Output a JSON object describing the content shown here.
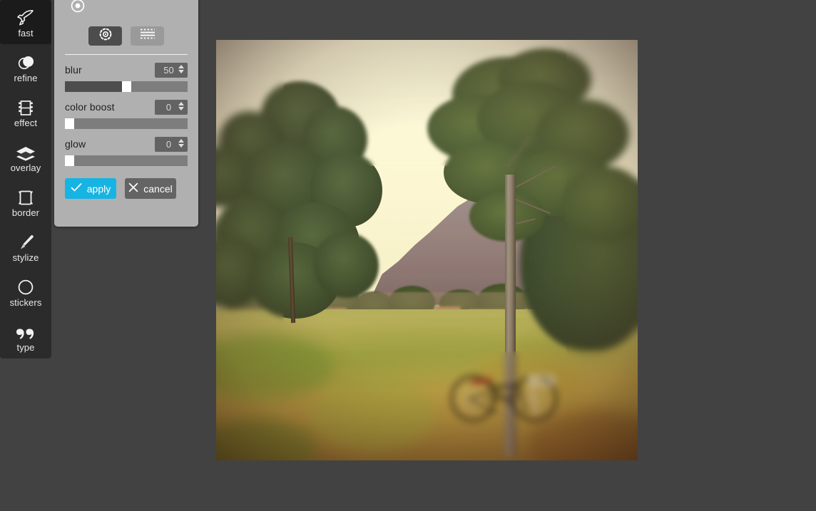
{
  "app": {
    "background_color": "#424242",
    "panel_color": "#b0b0b0",
    "accent_color": "#16b4e3",
    "sidebar_color": "#2b2b2b"
  },
  "sidebar": {
    "items": [
      {
        "label": "fast",
        "icon": "rocket-icon",
        "active": true
      },
      {
        "label": "refine",
        "icon": "contrast-icon",
        "active": false
      },
      {
        "label": "effect",
        "icon": "film-icon",
        "active": false
      },
      {
        "label": "overlay",
        "icon": "layers-icon",
        "active": false
      },
      {
        "label": "border",
        "icon": "frame-icon",
        "active": false
      },
      {
        "label": "stylize",
        "icon": "brush-icon",
        "active": false
      },
      {
        "label": "stickers",
        "icon": "sticker-icon",
        "active": false
      },
      {
        "label": "type",
        "icon": "quote-icon",
        "active": false
      }
    ]
  },
  "panel": {
    "header_icon": "target-icon",
    "modes": [
      {
        "name": "radial-tilt-shift",
        "icon": "radial-focus-icon",
        "selected": true
      },
      {
        "name": "linear-tilt-shift",
        "icon": "linear-focus-icon",
        "selected": false
      }
    ],
    "controls": [
      {
        "label": "blur",
        "value": "50",
        "fill_percent": 50,
        "name": "blur"
      },
      {
        "label": "color boost",
        "value": "0",
        "fill_percent": 0,
        "name": "color-boost"
      },
      {
        "label": "glow",
        "value": "0",
        "fill_percent": 0,
        "name": "glow"
      }
    ],
    "apply_label": "apply",
    "cancel_label": "cancel"
  },
  "canvas": {
    "photo_description": "park scene with pine tree, mountain, grass field and a black bicycle leaning on a tree"
  }
}
